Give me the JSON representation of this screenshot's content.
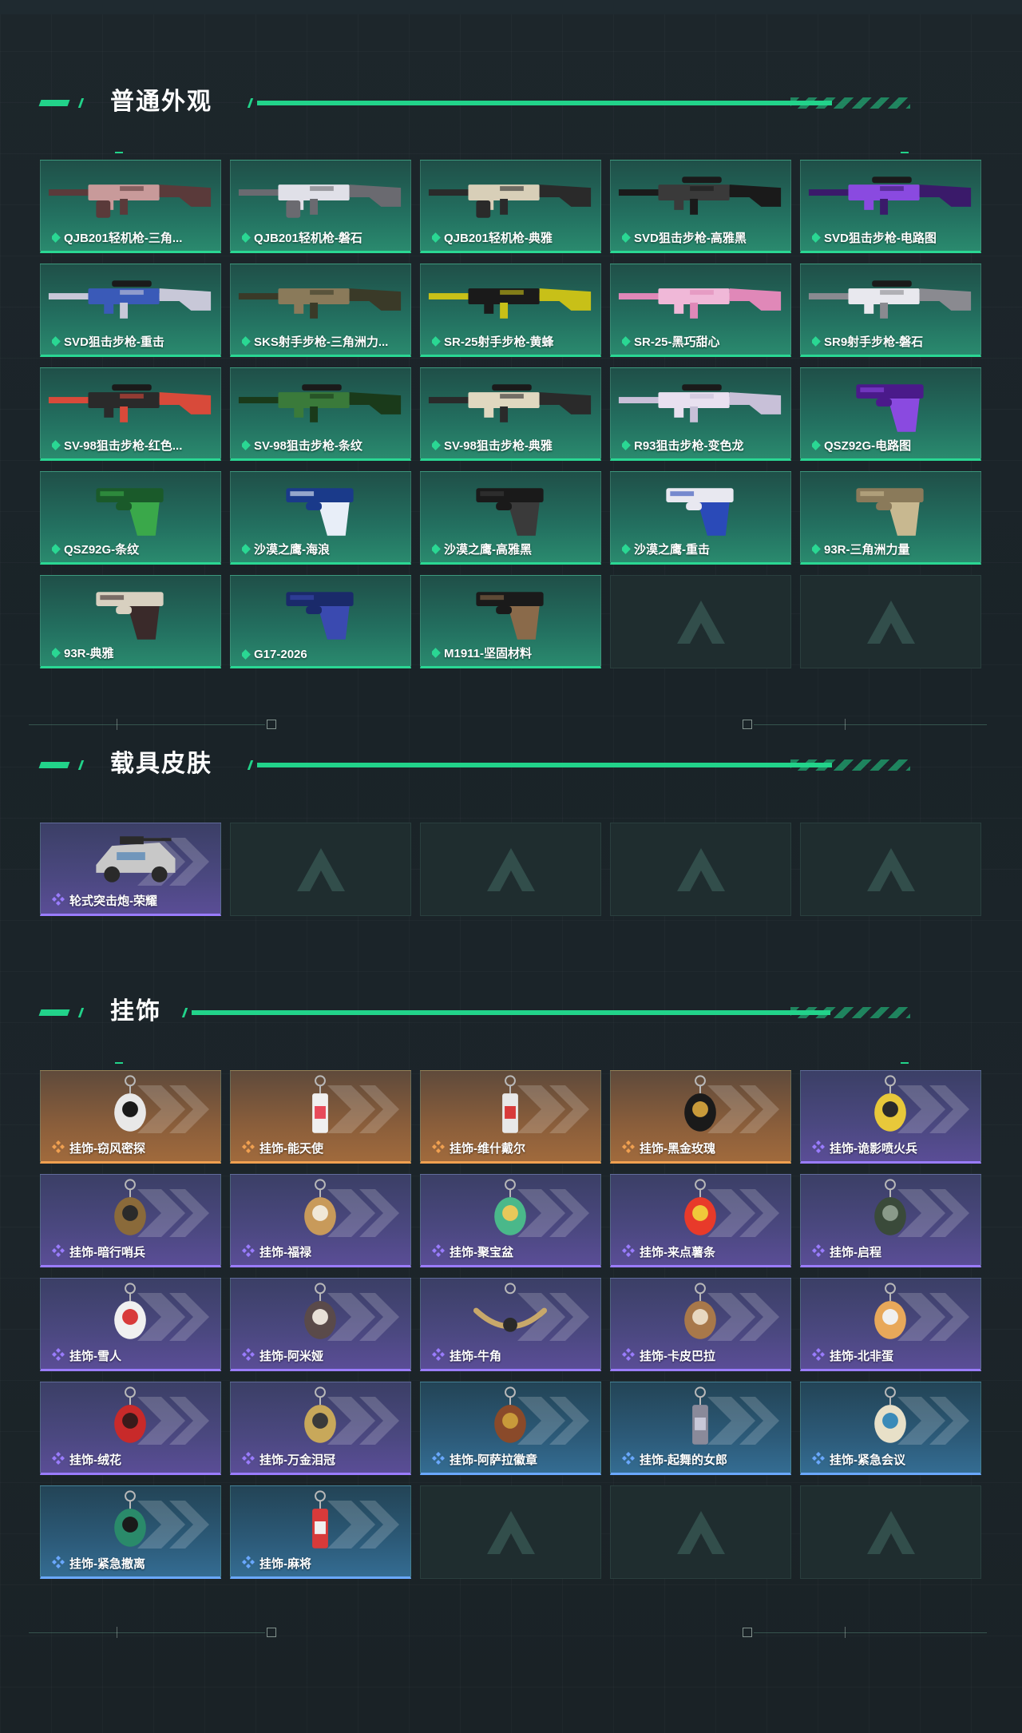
{
  "sections": {
    "weapons": {
      "title": "普通外观",
      "items": [
        {
          "label": "QJB201轻机枪-三角...",
          "rarity": "green",
          "kind": "lmg",
          "c1": "#5a3a3a",
          "c2": "#c89a9a"
        },
        {
          "label": "QJB201轻机枪-磐石",
          "rarity": "green",
          "kind": "lmg",
          "c1": "#6a6a70",
          "c2": "#e0e0e8"
        },
        {
          "label": "QJB201轻机枪-典雅",
          "rarity": "green",
          "kind": "lmg",
          "c1": "#2a2a2a",
          "c2": "#d8cfb8"
        },
        {
          "label": "SVD狙击步枪-高雅黑",
          "rarity": "green",
          "kind": "sniper",
          "c1": "#1a1a1a",
          "c2": "#3a3a3a"
        },
        {
          "label": "SVD狙击步枪-电路图",
          "rarity": "green",
          "kind": "sniper",
          "c1": "#3a1a6a",
          "c2": "#8a4ae0"
        },
        {
          "label": "SVD狙击步枪-重击",
          "rarity": "green",
          "kind": "sniper",
          "c1": "#c8c8d8",
          "c2": "#3a5ab8"
        },
        {
          "label": "SKS射手步枪-三角洲力...",
          "rarity": "green",
          "kind": "rifle",
          "c1": "#3a3a28",
          "c2": "#8a7a5a"
        },
        {
          "label": "SR-25射手步枪-黄蜂",
          "rarity": "green",
          "kind": "rifle",
          "c1": "#c8c018",
          "c2": "#1a1a1a"
        },
        {
          "label": "SR-25-黑巧甜心",
          "rarity": "green",
          "kind": "rifle",
          "c1": "#e088b8",
          "c2": "#f0b8d8"
        },
        {
          "label": "SR9射手步枪-磐石",
          "rarity": "green",
          "kind": "sniper",
          "c1": "#8a8a90",
          "c2": "#e8e8ee"
        },
        {
          "label": "SV-98狙击步枪-红色...",
          "rarity": "green",
          "kind": "sniper",
          "c1": "#d84a3a",
          "c2": "#2a2a2a"
        },
        {
          "label": "SV-98狙击步枪-条纹",
          "rarity": "green",
          "kind": "sniper",
          "c1": "#1a3a1a",
          "c2": "#3a7a3a"
        },
        {
          "label": "SV-98狙击步枪-典雅",
          "rarity": "green",
          "kind": "sniper",
          "c1": "#2a2a2a",
          "c2": "#e0d8c0"
        },
        {
          "label": "R93狙击步枪-变色龙",
          "rarity": "green",
          "kind": "sniper",
          "c1": "#c8c0d8",
          "c2": "#e8e0f0"
        },
        {
          "label": "QSZ92G-电路图",
          "rarity": "green",
          "kind": "pistol",
          "c1": "#4a1a8a",
          "c2": "#8a4ae0"
        },
        {
          "label": "QSZ92G-条纹",
          "rarity": "green",
          "kind": "pistol",
          "c1": "#1a5a2a",
          "c2": "#3aa84a"
        },
        {
          "label": "沙漠之鹰-海浪",
          "rarity": "green",
          "kind": "deagle",
          "c1": "#1a3a8a",
          "c2": "#e8eef8"
        },
        {
          "label": "沙漠之鹰-高雅黑",
          "rarity": "green",
          "kind": "deagle",
          "c1": "#1a1a1a",
          "c2": "#3a3a3a"
        },
        {
          "label": "沙漠之鹰-重击",
          "rarity": "green",
          "kind": "deagle",
          "c1": "#e8e8f0",
          "c2": "#2a4ab8"
        },
        {
          "label": "93R-三角洲力量",
          "rarity": "green",
          "kind": "pistol",
          "c1": "#8a7a5a",
          "c2": "#c8b890"
        },
        {
          "label": "93R-典雅",
          "rarity": "green",
          "kind": "pistol",
          "c1": "#d8d0c0",
          "c2": "#3a2a2a"
        },
        {
          "label": "G17-2026",
          "rarity": "green",
          "kind": "pistol",
          "c1": "#1a2a6a",
          "c2": "#3a4ab0"
        },
        {
          "label": "M1911-坚固材料",
          "rarity": "green",
          "kind": "pistol",
          "c1": "#1a1a1a",
          "c2": "#8a6a4a"
        },
        {
          "label": "",
          "rarity": "empty"
        },
        {
          "label": "",
          "rarity": "empty"
        }
      ]
    },
    "vehicles": {
      "title": "载具皮肤",
      "items": [
        {
          "label": "轮式突击炮-荣耀",
          "rarity": "purple",
          "kind": "vehicle",
          "c1": "#c8c8c8",
          "c2": "#2a2a2a"
        },
        {
          "label": "",
          "rarity": "empty"
        },
        {
          "label": "",
          "rarity": "empty"
        },
        {
          "label": "",
          "rarity": "empty"
        },
        {
          "label": "",
          "rarity": "empty"
        }
      ]
    },
    "charms": {
      "title": "挂饰",
      "items": [
        {
          "label": "挂饰-窃风密探",
          "rarity": "orange",
          "kind": "charm",
          "c1": "#e8e8e8",
          "c2": "#1a1a1a"
        },
        {
          "label": "挂饰-能天使",
          "rarity": "orange",
          "kind": "charm-tall",
          "c1": "#e84a5a",
          "c2": "#f0f0f0"
        },
        {
          "label": "挂饰-维什戴尔",
          "rarity": "orange",
          "kind": "charm-tall",
          "c1": "#d83a3a",
          "c2": "#e8e8e8"
        },
        {
          "label": "挂饰-黑金玫瑰",
          "rarity": "orange",
          "kind": "charm",
          "c1": "#1a1a1a",
          "c2": "#c89a3a"
        },
        {
          "label": "挂饰-诡影喷火兵",
          "rarity": "purple",
          "kind": "charm",
          "c1": "#e8c83a",
          "c2": "#2a2a2a"
        },
        {
          "label": "挂饰-暗行哨兵",
          "rarity": "purple",
          "kind": "charm",
          "c1": "#8a6a3a",
          "c2": "#2a2a2a"
        },
        {
          "label": "挂饰-福禄",
          "rarity": "purple",
          "kind": "charm",
          "c1": "#c89a5a",
          "c2": "#f0e8d8"
        },
        {
          "label": "挂饰-聚宝盆",
          "rarity": "purple",
          "kind": "charm",
          "c1": "#4ab88a",
          "c2": "#e8c85a"
        },
        {
          "label": "挂饰-来点薯条",
          "rarity": "purple",
          "kind": "charm",
          "c1": "#e83a2a",
          "c2": "#f0c83a"
        },
        {
          "label": "挂饰-启程",
          "rarity": "purple",
          "kind": "charm",
          "c1": "#3a4a3a",
          "c2": "#8a9a8a"
        },
        {
          "label": "挂饰-雪人",
          "rarity": "purple",
          "kind": "charm",
          "c1": "#f0f0f0",
          "c2": "#d83a3a"
        },
        {
          "label": "挂饰-阿米娅",
          "rarity": "purple",
          "kind": "charm",
          "c1": "#5a4a4a",
          "c2": "#e8e0d8"
        },
        {
          "label": "挂饰-牛角",
          "rarity": "purple",
          "kind": "horns",
          "c1": "#c8a86a",
          "c2": "#2a2a2a"
        },
        {
          "label": "挂饰-卡皮巴拉",
          "rarity": "purple",
          "kind": "charm",
          "c1": "#a8784a",
          "c2": "#e8d8c0"
        },
        {
          "label": "挂饰-北非蛋",
          "rarity": "purple",
          "kind": "charm",
          "c1": "#e8a85a",
          "c2": "#f0f0f0"
        },
        {
          "label": "挂饰-绒花",
          "rarity": "purple",
          "kind": "charm",
          "c1": "#c82a2a",
          "c2": "#3a1a1a"
        },
        {
          "label": "挂饰-万金泪冠",
          "rarity": "purple",
          "kind": "charm",
          "c1": "#c8a85a",
          "c2": "#3a3a3a"
        },
        {
          "label": "挂饰-阿萨拉徽章",
          "rarity": "blue",
          "kind": "charm",
          "c1": "#8a4a2a",
          "c2": "#c89a3a"
        },
        {
          "label": "挂饰-起舞的女郎",
          "rarity": "blue",
          "kind": "charm-tall",
          "c1": "#c8c8d8",
          "c2": "#8a8a9a"
        },
        {
          "label": "挂饰-紧急会议",
          "rarity": "blue",
          "kind": "charm",
          "c1": "#e8e0c8",
          "c2": "#3a8ab8"
        },
        {
          "label": "挂饰-紧急撤离",
          "rarity": "blue",
          "kind": "charm",
          "c1": "#2a8a6a",
          "c2": "#1a1a1a"
        },
        {
          "label": "挂饰-麻将",
          "rarity": "blue",
          "kind": "charm-tall",
          "c1": "#f0f0f0",
          "c2": "#d83a3a"
        },
        {
          "label": "",
          "rarity": "empty"
        },
        {
          "label": "",
          "rarity": "empty"
        },
        {
          "label": "",
          "rarity": "empty"
        }
      ]
    }
  },
  "colors": {
    "accent": "#22d38a",
    "green_rarity": "#2ad793",
    "purple_rarity": "#9a7cff",
    "orange_rarity": "#f0a050",
    "blue_rarity": "#6aa8ff"
  }
}
